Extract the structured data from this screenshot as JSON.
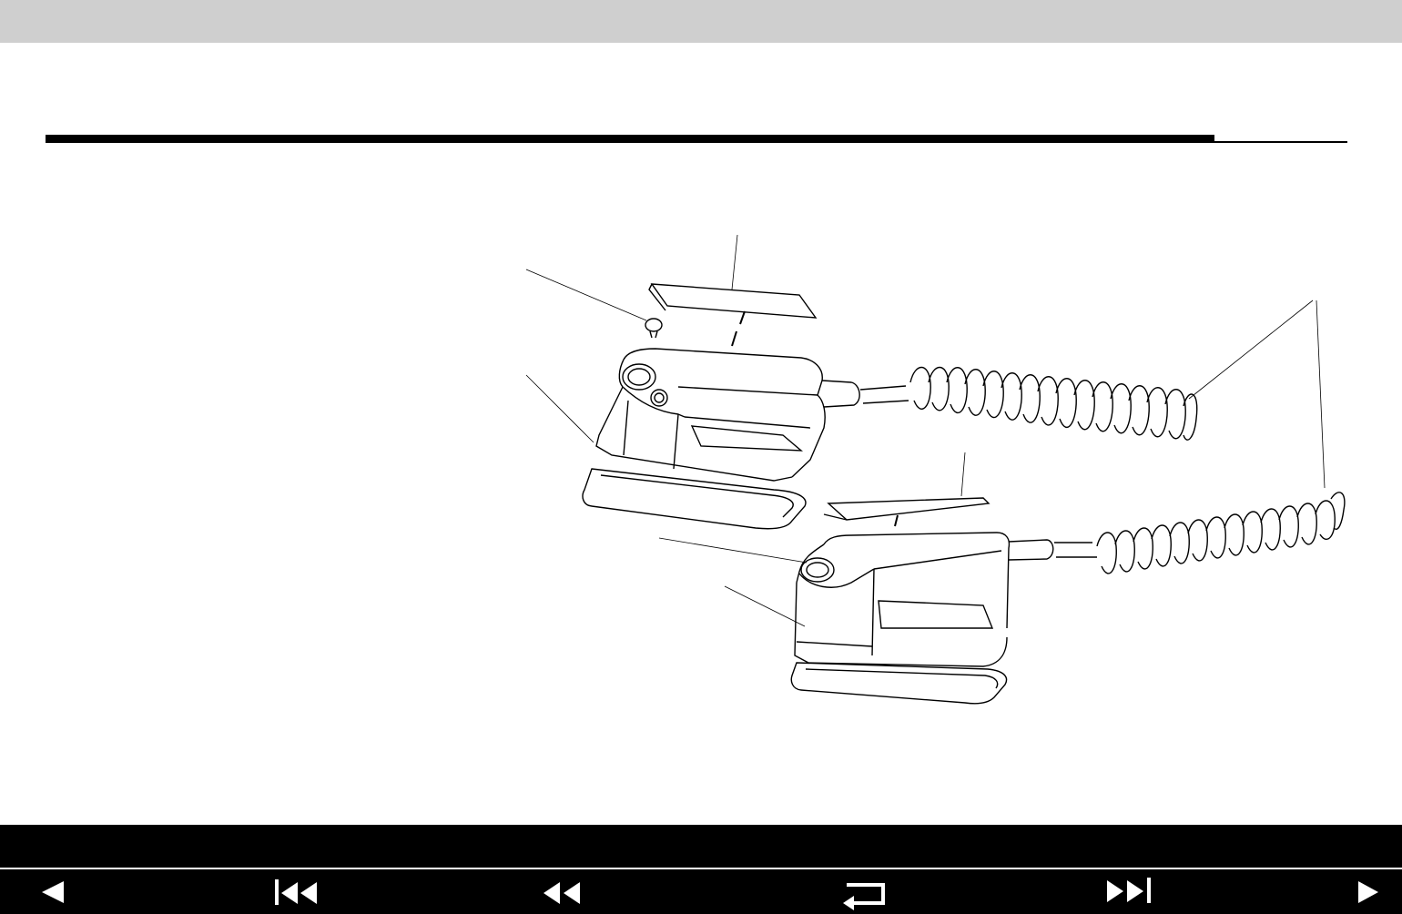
{
  "page": {
    "diagram_description": ""
  },
  "navigation": {
    "items": [
      {
        "id": "prev-page",
        "icon": "triangle-left-icon"
      },
      {
        "id": "first-page",
        "icon": "skip-to-start-icon"
      },
      {
        "id": "back",
        "icon": "rewind-icon"
      },
      {
        "id": "return",
        "icon": "return-arrow-icon"
      },
      {
        "id": "last-page",
        "icon": "skip-to-end-icon"
      },
      {
        "id": "next-page",
        "icon": "triangle-right-icon"
      }
    ]
  },
  "colors": {
    "top_bar": "#cfcfcf",
    "bottom_bar": "#000000",
    "rule": "#000000",
    "icon": "#ffffff"
  }
}
